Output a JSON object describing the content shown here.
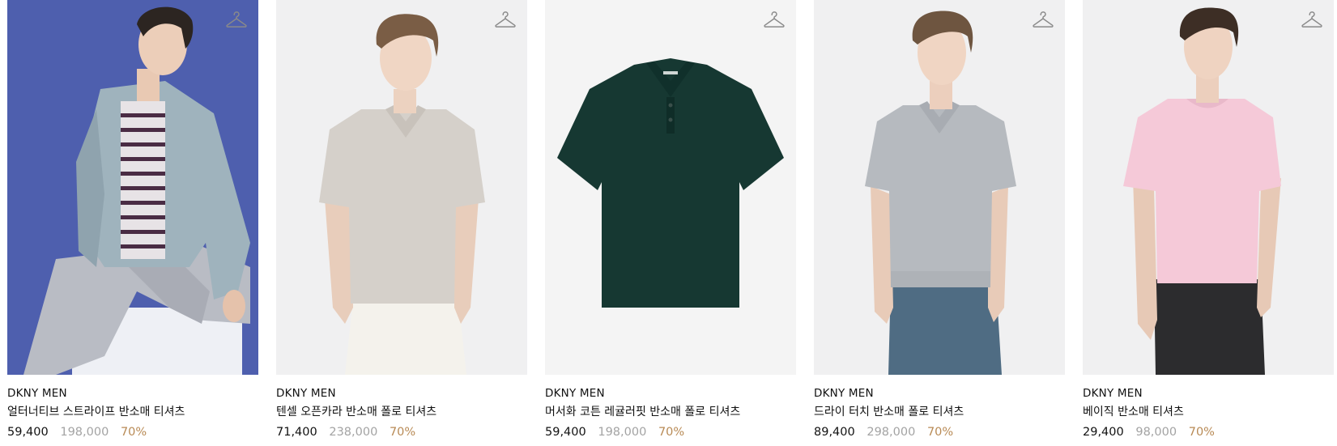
{
  "colors": {
    "discount": "#b88a55",
    "original_price": "#a3a3a3",
    "text": "#111111"
  },
  "products": [
    {
      "brand": "DKNY MEN",
      "name": "얼터너티브 스트라이프 반소매 티셔츠",
      "sale_price": "59,400",
      "original_price": "198,000",
      "discount": "70%",
      "image": "model-linen-shirt-blue-background",
      "wishlist_icon": "hanger-icon"
    },
    {
      "brand": "DKNY MEN",
      "name": "텐셀 오픈카라 반소매 폴로 티셔츠",
      "sale_price": "71,400",
      "original_price": "238,000",
      "discount": "70%",
      "image": "model-beige-polo",
      "wishlist_icon": "hanger-icon"
    },
    {
      "brand": "DKNY MEN",
      "name": "머서화 코튼 레귤러핏 반소매 폴로 티셔츠",
      "sale_price": "59,400",
      "original_price": "198,000",
      "discount": "70%",
      "image": "flat-dark-green-polo",
      "wishlist_icon": "hanger-icon"
    },
    {
      "brand": "DKNY MEN",
      "name": "드라이 터치 반소매 폴로 티셔츠",
      "sale_price": "89,400",
      "original_price": "298,000",
      "discount": "70%",
      "image": "model-grey-knit-polo",
      "wishlist_icon": "hanger-icon"
    },
    {
      "brand": "DKNY MEN",
      "name": "베이직 반소매 티셔츠",
      "sale_price": "29,400",
      "original_price": "98,000",
      "discount": "70%",
      "image": "model-pink-tshirt",
      "wishlist_icon": "hanger-icon"
    }
  ]
}
